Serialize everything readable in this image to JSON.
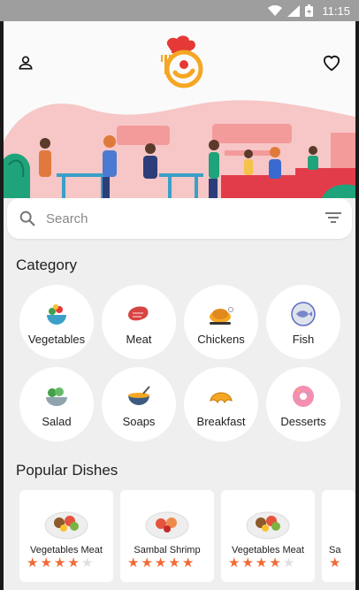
{
  "status": {
    "time": "11:15"
  },
  "search": {
    "placeholder": "Search"
  },
  "sections": {
    "category": "Category",
    "popular": "Popular Dishes"
  },
  "categories": [
    {
      "label": "Vegetables",
      "icon": "vegetables-icon"
    },
    {
      "label": "Meat",
      "icon": "meat-icon"
    },
    {
      "label": "Chickens",
      "icon": "chicken-icon"
    },
    {
      "label": "Fish",
      "icon": "fish-icon"
    },
    {
      "label": "Salad",
      "icon": "salad-icon"
    },
    {
      "label": "Soaps",
      "icon": "soup-icon"
    },
    {
      "label": "Breakfast",
      "icon": "croissant-icon"
    },
    {
      "label": "Desserts",
      "icon": "donut-icon"
    }
  ],
  "dishes": [
    {
      "name": "Vegetables Meat",
      "rating": 4
    },
    {
      "name": "Sambal Shrimp",
      "rating": 5
    },
    {
      "name": "Vegetables Meat",
      "rating": 4
    },
    {
      "name": "Sa",
      "rating": 1
    }
  ],
  "colors": {
    "star_on": "#f06a35",
    "star_off": "#e0e0e0",
    "logo_orange": "#f5a623",
    "logo_red": "#e53935",
    "banner_pink": "#f7c6c6"
  }
}
